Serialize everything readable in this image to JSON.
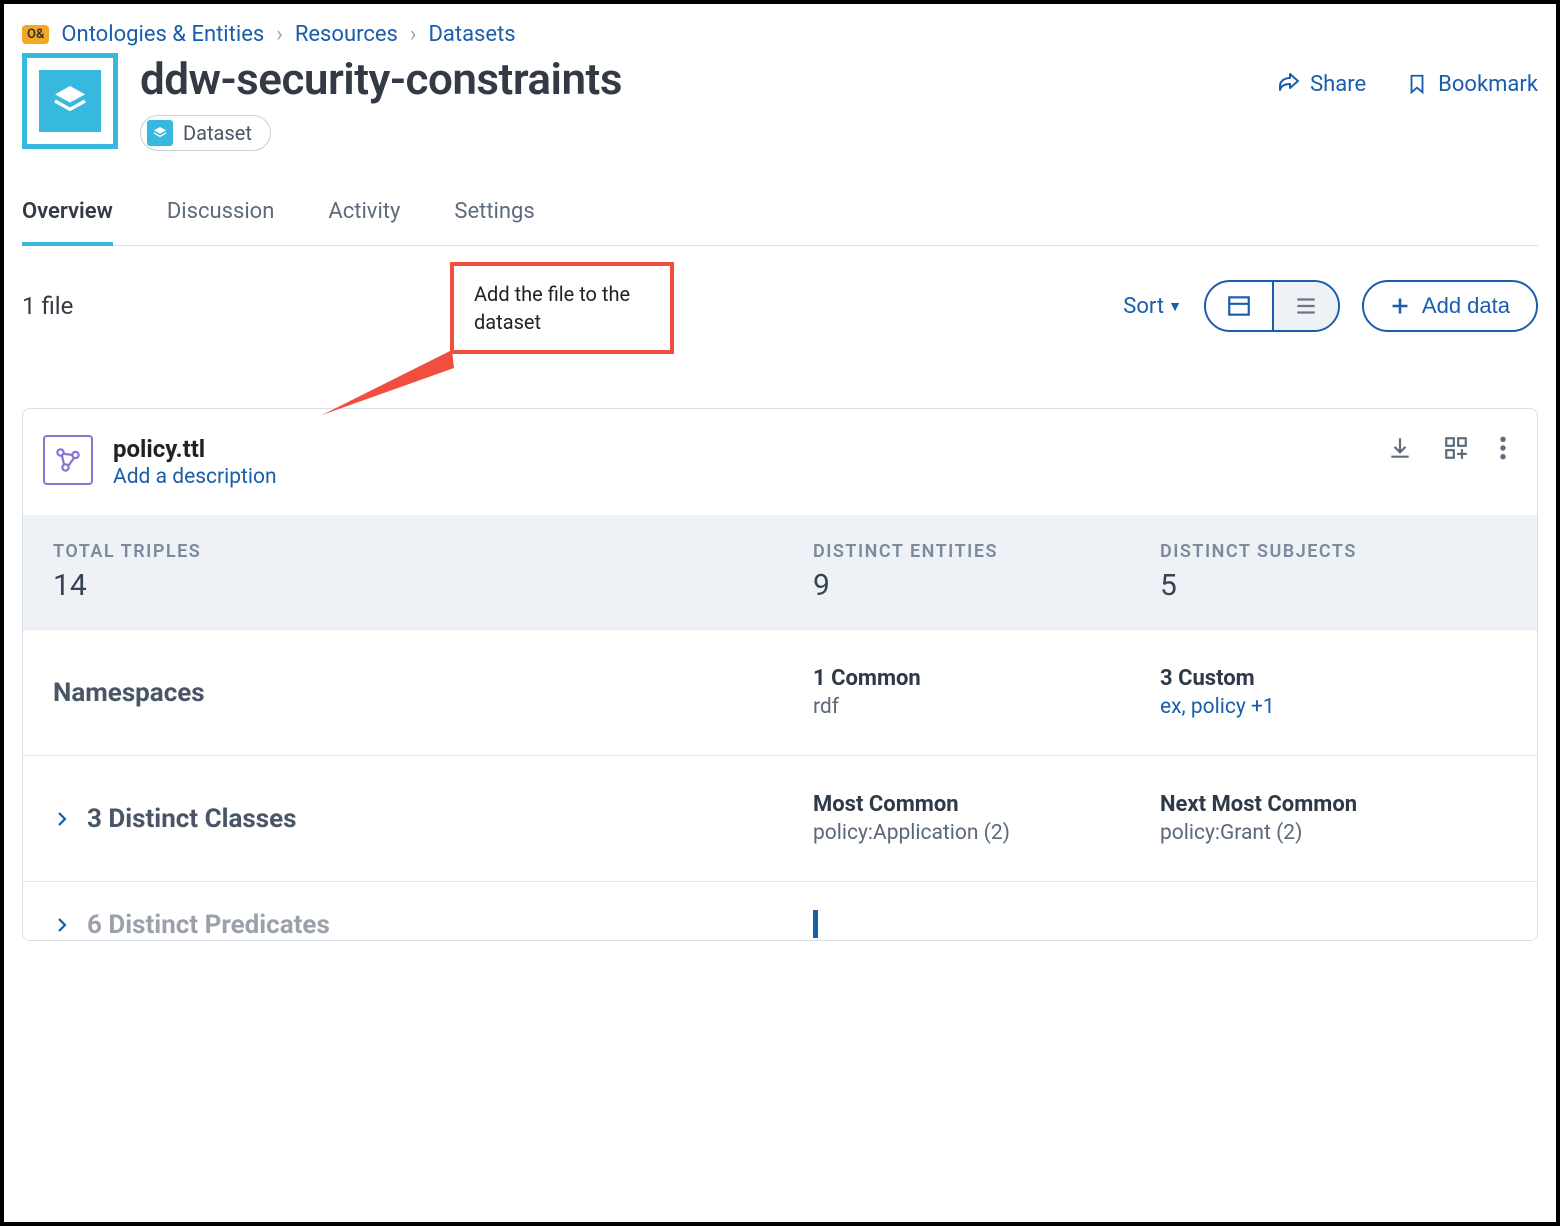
{
  "breadcrumb": {
    "badge": "O&",
    "items": [
      "Ontologies & Entities",
      "Resources",
      "Datasets"
    ]
  },
  "title": "ddw-security-constraints",
  "type_badge": "Dataset",
  "actions": {
    "share": "Share",
    "bookmark": "Bookmark"
  },
  "tabs": [
    "Overview",
    "Discussion",
    "Activity",
    "Settings"
  ],
  "active_tab": 0,
  "toolbar": {
    "file_count": "1 file",
    "callout": "Add the file to the dataset",
    "sort_label": "Sort",
    "add_data_label": "Add data"
  },
  "file": {
    "name": "policy.ttl",
    "desc_prompt": "Add a description"
  },
  "stats": {
    "triples_label": "TOTAL TRIPLES",
    "triples_value": "14",
    "entities_label": "DISTINCT ENTITIES",
    "entities_value": "9",
    "subjects_label": "DISTINCT SUBJECTS",
    "subjects_value": "5"
  },
  "namespaces": {
    "heading": "Namespaces",
    "common_title": "1 Common",
    "common_sub": "rdf",
    "custom_title": "3 Custom",
    "custom_sub": "ex, policy +1"
  },
  "classes": {
    "heading": "3 Distinct Classes",
    "most_title": "Most Common",
    "most_sub": "policy:Application (2)",
    "next_title": "Next Most Common",
    "next_sub": "policy:Grant (2)"
  },
  "predicates": {
    "heading": "6 Distinct Predicates"
  }
}
